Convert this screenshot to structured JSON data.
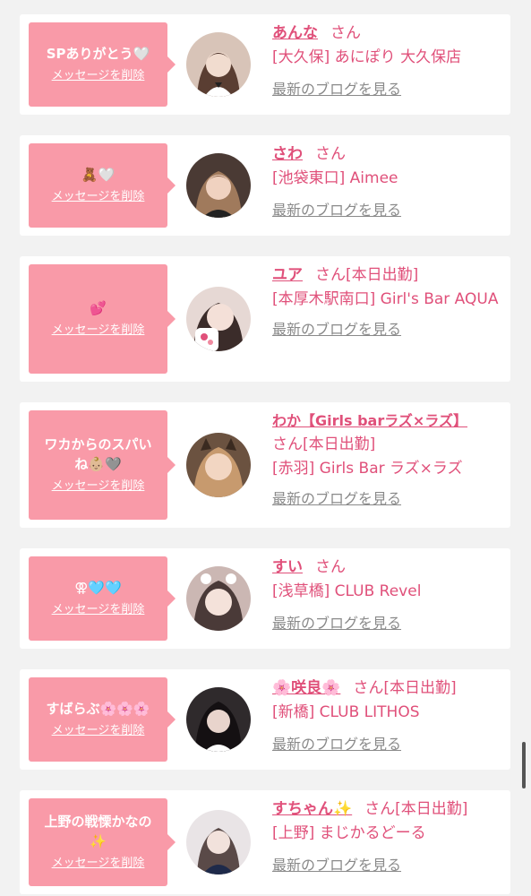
{
  "common": {
    "delete_label": "メッセージを削除",
    "blog_label": "最新のブログを見る"
  },
  "items": [
    {
      "message": "SPありがとう🤍",
      "name": "あんな",
      "suffix": "さん",
      "shop": "[大久保] あにぽり 大久保店",
      "avatar_color": "#d8c4b8"
    },
    {
      "message": "🧸🤍",
      "name": "さわ",
      "suffix": "さん",
      "shop": "[池袋東口] Aimee",
      "avatar_color": "#8a6a54"
    },
    {
      "message": "💕",
      "name": "ユア",
      "suffix": "さん[本日出勤]",
      "shop": "[本厚木駅南口] Girl's Bar AQUA",
      "avatar_color": "#e6d8d4"
    },
    {
      "message": "ワカからのスパいね👶🏼🩶",
      "name": "わか【Girls barラズ×ラズ】",
      "suffix": "さん[本日出勤]",
      "shop": "[赤羽] Girls Bar ラズ×ラズ",
      "avatar_color": "#b88d64"
    },
    {
      "message": "⚢🩵🩵",
      "name": "すい",
      "suffix": "さん",
      "shop": "[浅草橋] CLUB Revel",
      "avatar_color": "#cbb7b3"
    },
    {
      "message": "すばらぶ🌸🌸🌸",
      "name": "🌸咲良🌸",
      "suffix": "さん[本日出勤]",
      "shop": "[新橋] CLUB LITHOS",
      "avatar_color": "#2f2a2c"
    },
    {
      "message": "上野の戦慄かなの✨",
      "name": "すちゃん✨",
      "suffix": "さん[本日出勤]",
      "shop": "[上野] まじかるどーる",
      "avatar_color": "#e9e4e6"
    }
  ]
}
